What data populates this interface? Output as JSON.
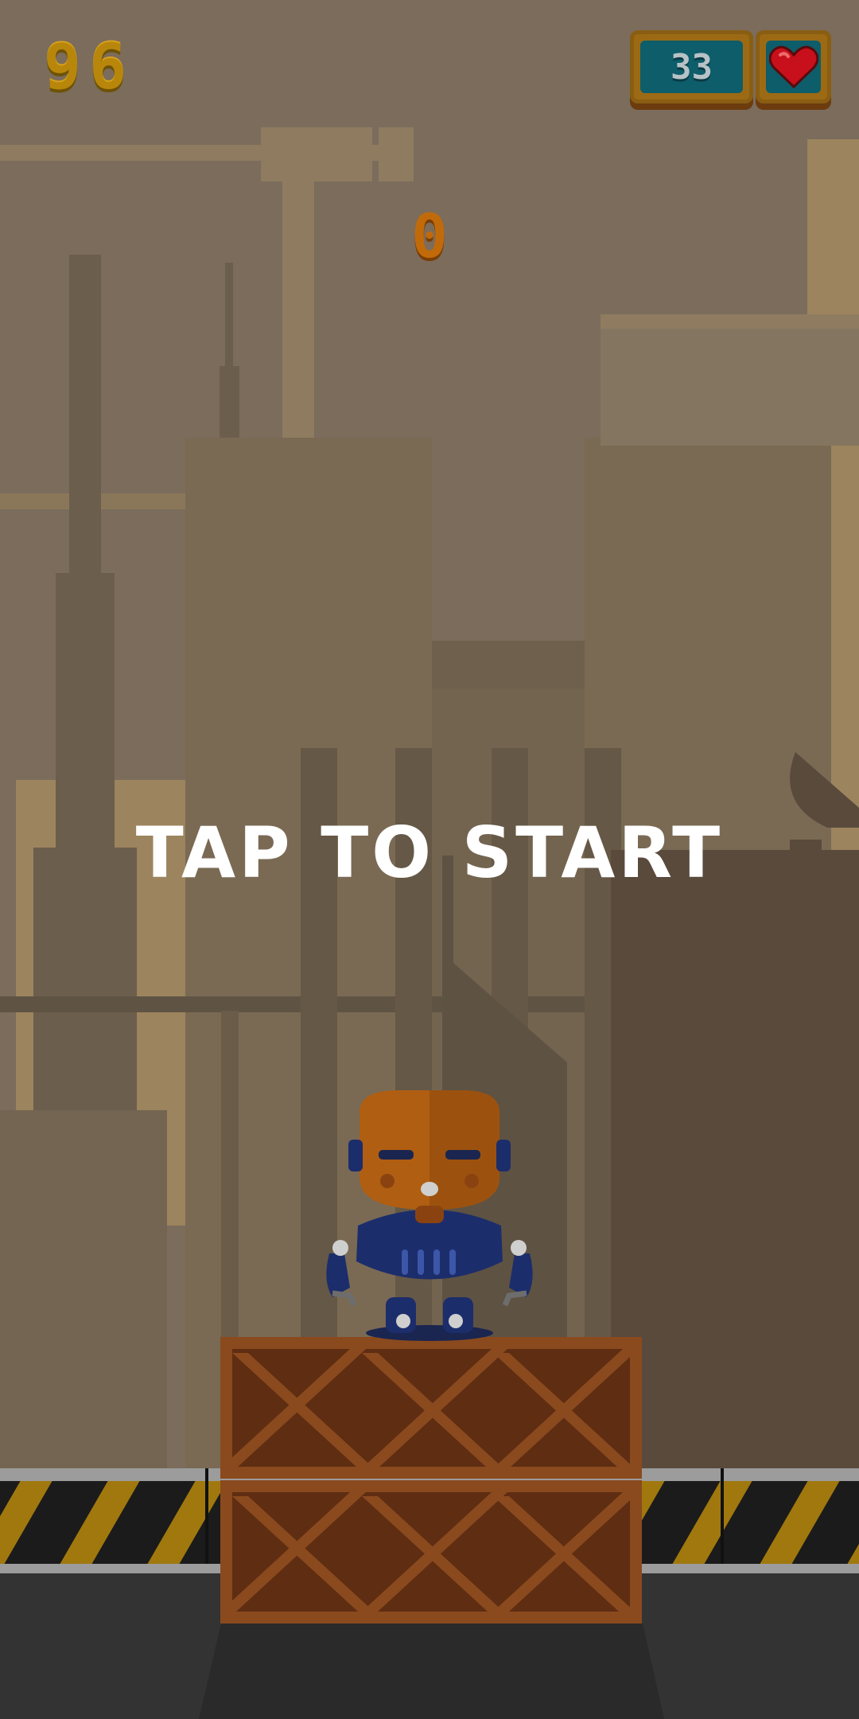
{
  "hud": {
    "best_score": "96",
    "coins": "33"
  },
  "game": {
    "score": "0",
    "prompt": "TAP TO START"
  },
  "icons": {
    "life": "heart-icon"
  },
  "colors": {
    "sky": "#7b6c5c",
    "coin_panel": "#0d5d6b",
    "heart": "#c8101c",
    "crate": "#8a4a1e"
  }
}
